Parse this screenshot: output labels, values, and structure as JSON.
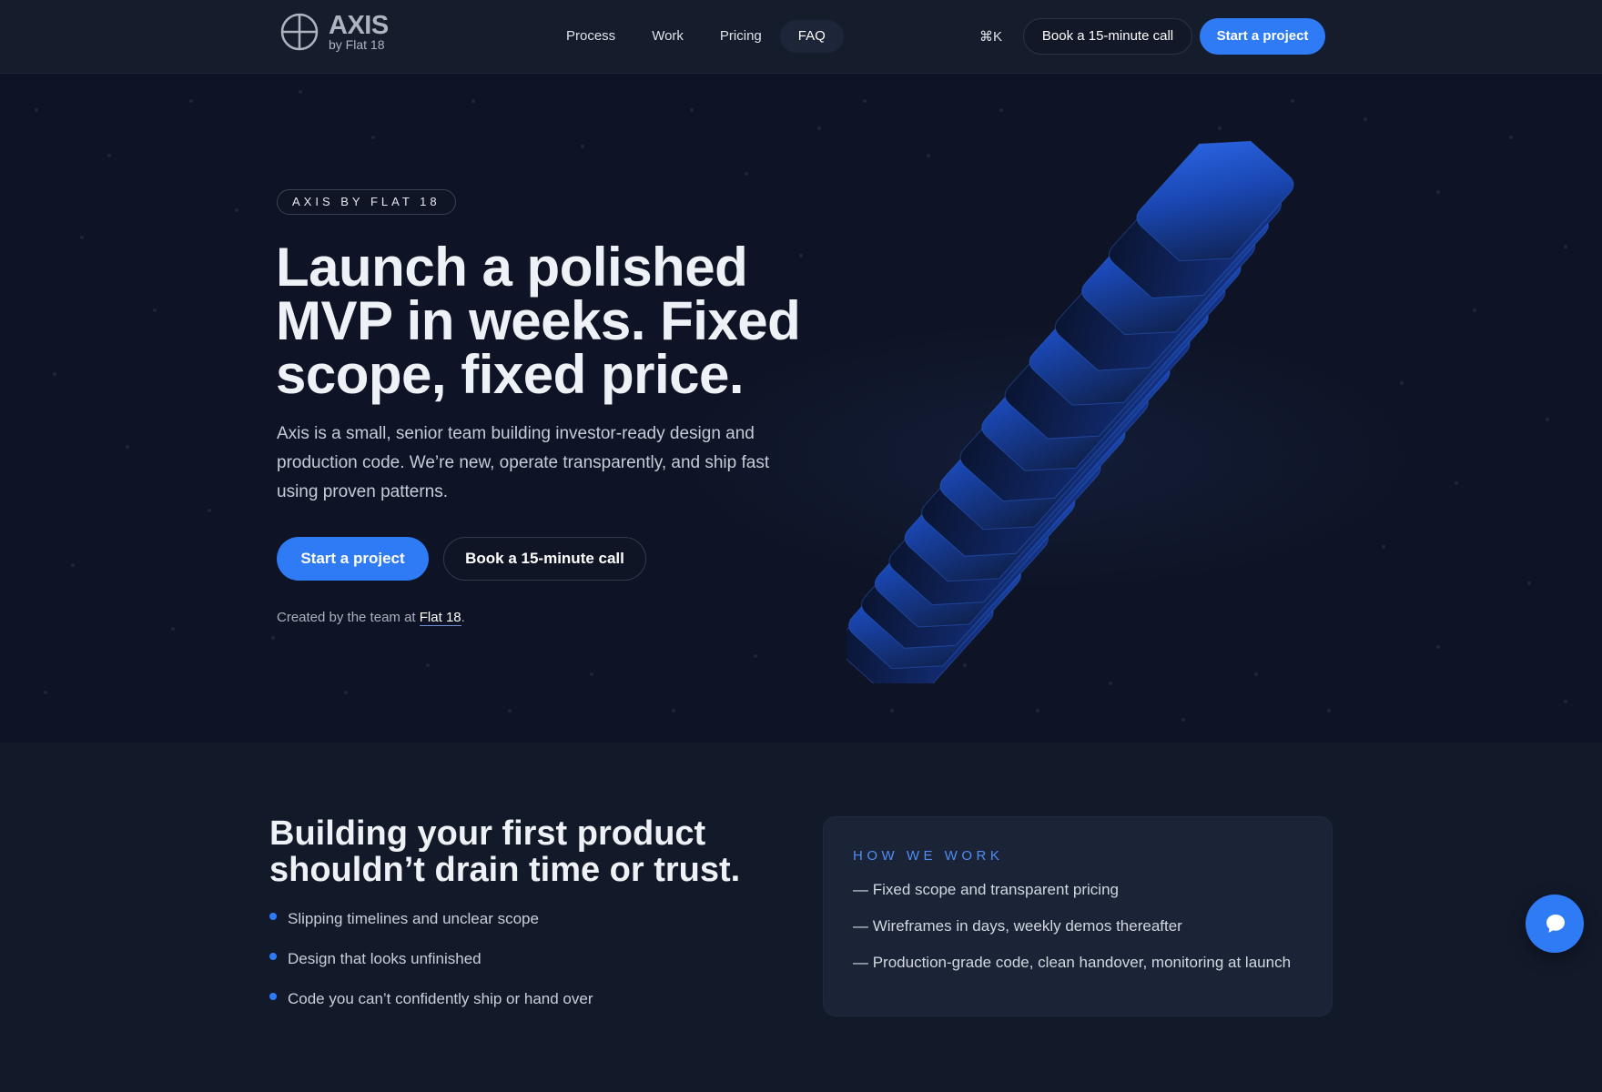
{
  "nav": {
    "logo_name": "AXIS",
    "logo_sub": "by Flat 18",
    "links": [
      {
        "label": "Process"
      },
      {
        "label": "Work"
      },
      {
        "label": "Pricing"
      },
      {
        "label": "FAQ"
      }
    ],
    "shortcut": "⌘K",
    "call_label": "Book a 15-minute call",
    "start_label": "Start a project"
  },
  "hero": {
    "eyebrow": "AXIS BY FLAT 18",
    "headline": "Launch a polished MVP in weeks. Fixed scope, fixed price.",
    "lede": "Axis is a small, senior team building investor-ready design and production code. We’re new, operate transparently, and ship fast using proven patterns.",
    "start_label": "Start a project",
    "call_label": "Book a 15-minute call",
    "credit_prefix": "Created by the team at ",
    "credit_link": "Flat 18",
    "credit_suffix": "."
  },
  "problem": {
    "title": "Building your first product shouldn’t drain time or trust.",
    "items": [
      "Slipping timelines and unclear scope",
      "Design that looks unfinished",
      "Code you can’t confidently ship or hand over"
    ]
  },
  "how_we_work": {
    "label": "HOW WE WORK",
    "items": [
      "— Fixed scope and transparent pricing",
      "— Wireframes in days, weekly demos thereafter",
      "— Production-grade code, clean handover, monitoring at launch"
    ]
  },
  "colors": {
    "accent": "#2f7bf5",
    "background": "#0e1425",
    "card": "#1a2436"
  },
  "icons": {
    "logo": "crosshair-circle-icon",
    "chat": "chat-bubble-icon"
  }
}
